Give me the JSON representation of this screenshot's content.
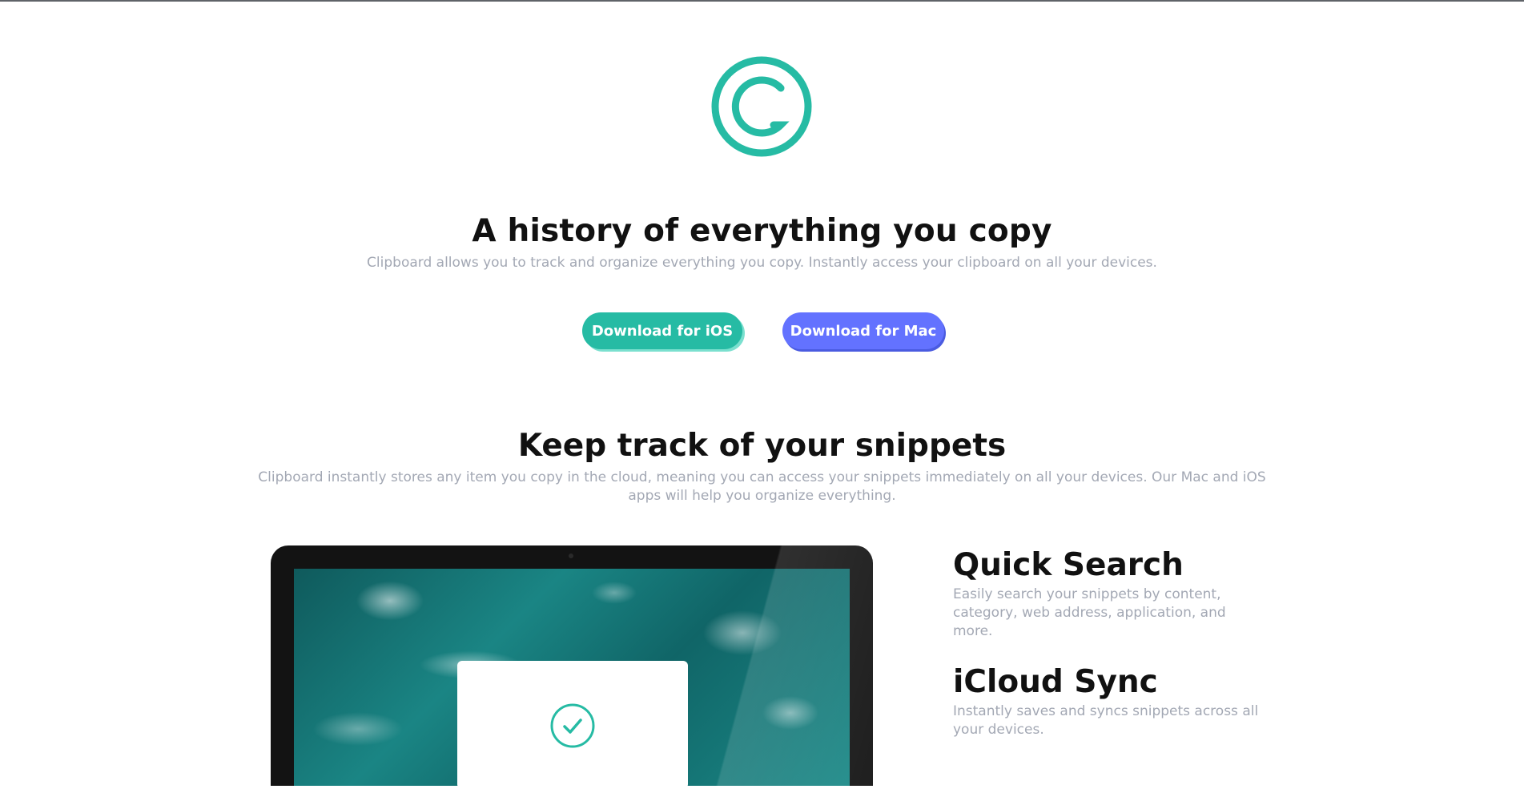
{
  "hero": {
    "title": "A history of everything you copy",
    "subtitle": "Clipboard allows you to track and organize everything you copy. Instantly access your clipboard on all your devices.",
    "btn_ios": "Download for iOS",
    "btn_mac": "Download for Mac"
  },
  "snippets": {
    "title": "Keep track of your snippets",
    "subtitle": "Clipboard instantly stores any item you copy in the cloud, meaning you can access your snippets immediately on all your devices. Our Mac and iOS apps will help you organize everything."
  },
  "features": [
    {
      "title": "Quick Search",
      "text": "Easily search your snippets by content, category, web address, application, and more."
    },
    {
      "title": "iCloud Sync",
      "text": "Instantly saves and syncs snippets across all your devices."
    }
  ],
  "icons": {
    "logo": "clipboard-logo-icon",
    "check": "checkmark-circle-icon"
  },
  "colors": {
    "accent_teal": "#26bba4",
    "accent_blue": "#6372ff",
    "heading": "#111111",
    "muted": "#a3a8b4"
  }
}
